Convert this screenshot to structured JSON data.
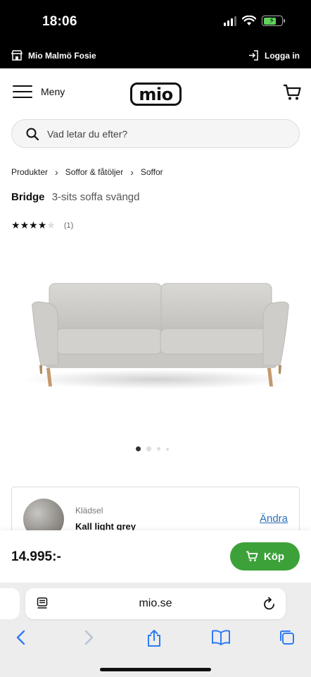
{
  "status": {
    "time": "18:06"
  },
  "storebar": {
    "store_name": "Mio Malmö Fosie",
    "login_label": "Logga in"
  },
  "header": {
    "menu_label": "Meny",
    "logo_text": "mio"
  },
  "search": {
    "placeholder": "Vad letar du efter?"
  },
  "breadcrumb": [
    "Produkter",
    "Soffor & fåtöljer",
    "Soffor"
  ],
  "product": {
    "brand": "Bridge",
    "name": "3-sits soffa svängd",
    "rating": 4,
    "rating_max": 5,
    "review_count": "(1)",
    "image_count": 4,
    "active_image": 1
  },
  "upholstery": {
    "label": "Klädsel",
    "value": "Kall light grey",
    "change_label": "Ändra"
  },
  "buy": {
    "price": "14.995:-",
    "button_label": "Köp",
    "button_color": "#3da13a"
  },
  "browser": {
    "url": "mio.se"
  },
  "colors": {
    "accent_link": "#2b6fb8",
    "buy_green": "#3da13a"
  }
}
